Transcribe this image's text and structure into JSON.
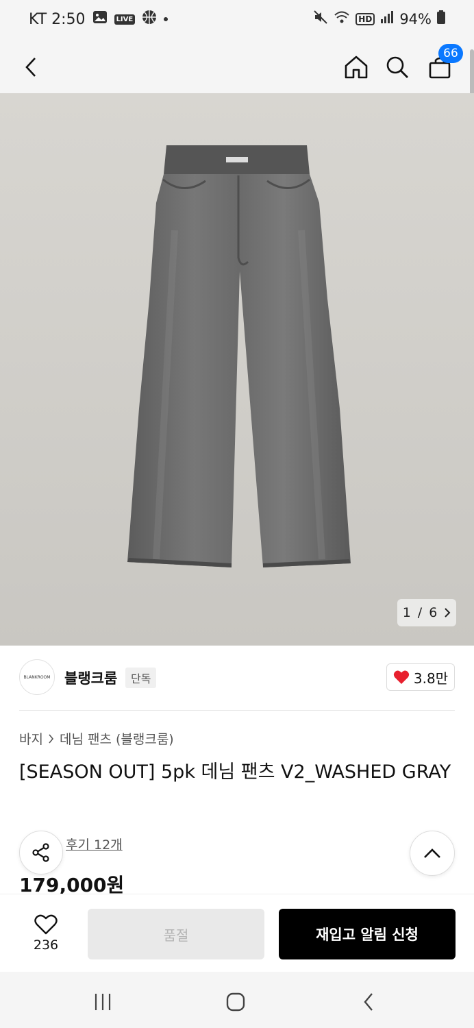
{
  "status_bar": {
    "carrier_time": "KT 2:50",
    "live_label": "LIVE",
    "hd_label": "HD",
    "battery": "94%"
  },
  "header": {
    "cart_count": "66"
  },
  "gallery": {
    "current": "1",
    "separator": "/",
    "total": "6"
  },
  "brand": {
    "logo_text": "BLANKROOM",
    "name": "블랭크룸",
    "badge": "단독",
    "likes": "3.8만"
  },
  "breadcrumb": {
    "category": "바지",
    "subcategory": "데님 팬츠 (블랭크룸)"
  },
  "product": {
    "title": "[SEASON OUT] 5pk 데님 팬츠 V2_WASHED GRAY",
    "review_link": "후기 12개",
    "price": "179,000원"
  },
  "purchase_bar": {
    "wish_count": "236",
    "soldout_label": "품절",
    "restock_label": "재입고 알림 신청"
  },
  "colors": {
    "accent_blue": "#0a78ff",
    "heart_red": "#e8202e"
  }
}
